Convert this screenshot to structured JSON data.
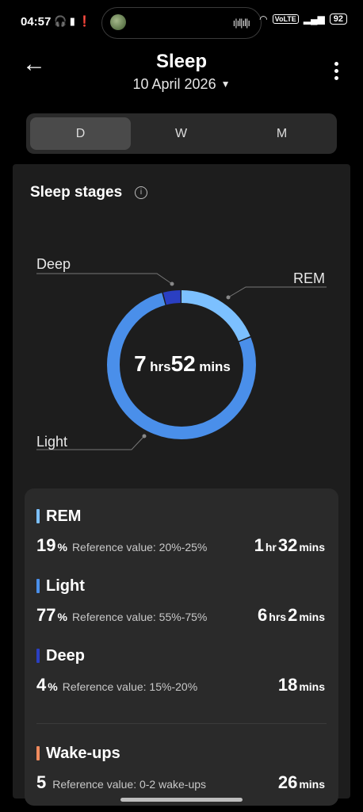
{
  "status": {
    "time": "04:57",
    "battery": "92",
    "volte": "VoLTE"
  },
  "header": {
    "title": "Sleep",
    "date": "10 April 2026"
  },
  "tabs": [
    {
      "label": "D",
      "active": true
    },
    {
      "label": "W",
      "active": false
    },
    {
      "label": "M",
      "active": false
    }
  ],
  "sleep_stages": {
    "title": "Sleep stages",
    "total": {
      "hrs": "7",
      "hrs_unit": "hrs",
      "mins": "52",
      "mins_unit": "mins"
    },
    "labels": {
      "deep": "Deep",
      "rem": "REM",
      "light": "Light"
    }
  },
  "chart_data": {
    "type": "pie",
    "slices": [
      {
        "label": "REM",
        "percent": 19,
        "color": "#7cc0ff"
      },
      {
        "label": "Light",
        "percent": 77,
        "color": "#4a8fea"
      },
      {
        "label": "Deep",
        "percent": 4,
        "color": "#2a3fc2"
      }
    ]
  },
  "details": [
    {
      "name": "REM",
      "color": "#7cc0ff",
      "pct": "19",
      "pct_unit": "%",
      "ref": "Reference value: 20%-25%",
      "dur": [
        {
          "n": "1",
          "u": "hr"
        },
        {
          "n": "32",
          "u": "mins"
        }
      ]
    },
    {
      "name": "Light",
      "color": "#4a8fea",
      "pct": "77",
      "pct_unit": "%",
      "ref": "Reference value: 55%-75%",
      "dur": [
        {
          "n": "6",
          "u": "hrs"
        },
        {
          "n": "2",
          "u": "mins"
        }
      ]
    },
    {
      "name": "Deep",
      "color": "#2a3fc2",
      "pct": "4",
      "pct_unit": "%",
      "ref": "Reference value: 15%-20%",
      "dur": [
        {
          "n": "18",
          "u": "mins"
        }
      ]
    },
    {
      "name": "Wake-ups",
      "color": "#f08a5d",
      "pct": "5",
      "pct_unit": "",
      "ref": "Reference value: 0-2 wake-ups",
      "dur": [
        {
          "n": "26",
          "u": "mins"
        }
      ]
    }
  ]
}
